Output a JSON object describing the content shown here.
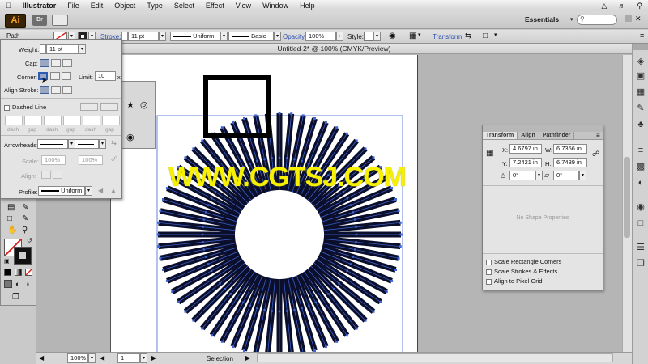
{
  "menubar": {
    "items": [
      "Illustrator",
      "File",
      "Edit",
      "Object",
      "Type",
      "Select",
      "Effect",
      "View",
      "Window",
      "Help"
    ]
  },
  "appbar": {
    "logo": "Ai",
    "bridge": "Br",
    "workspace": "Essentials"
  },
  "control": {
    "selection_label": "Path",
    "stroke_label": "Stroke:",
    "stroke_weight": "11 pt",
    "profile_uniform": "Uniform",
    "brush_basic": "Basic",
    "opacity_label": "Opacity:",
    "opacity_value": "100%",
    "style_label": "Style:",
    "transform_label": "Transform"
  },
  "stroke_panel": {
    "weight_label": "Weight:",
    "weight_value": "11 pt",
    "cap_label": "Cap:",
    "corner_label": "Corner:",
    "limit_label": "Limit:",
    "limit_value": "10",
    "limit_unit": "x",
    "align_label": "Align Stroke:",
    "dashed_label": "Dashed Line",
    "dash_labels": [
      "dash",
      "gap",
      "dash",
      "gap",
      "dash",
      "gap"
    ],
    "arrowheads_label": "Arrowheads:",
    "scale_label": "Scale:",
    "scale_values": [
      "100%",
      "100%"
    ],
    "align_arrow_label": "Align:",
    "profile_label": "Profile:",
    "profile_value": "Uniform"
  },
  "document": {
    "title": "Untitled-2* @ 100% (CMYK/Preview)"
  },
  "transform_panel": {
    "tabs": [
      "Transform",
      "Align",
      "Pathfinder"
    ],
    "x_label": "X:",
    "x_value": "4.6797 in",
    "y_label": "Y:",
    "y_value": "7.2421 in",
    "w_label": "W:",
    "w_value": "6.7356 in",
    "h_label": "H:",
    "h_value": "6.7489 in",
    "rotate_value": "0°",
    "shear_value": "0°",
    "no_shape": "No Shape Properties",
    "checks": [
      "Scale Rectangle Corners",
      "Scale Strokes & Effects",
      "Align to Pixel Grid"
    ]
  },
  "statusbar": {
    "zoom": "100%",
    "page": "1",
    "tool": "Selection"
  },
  "watermark": "WWW.CGTSJ.COM",
  "colors": {
    "spoke": "#0b0f2b",
    "spoke_outline": "#3f66d8",
    "watermark": "#f7f000"
  }
}
